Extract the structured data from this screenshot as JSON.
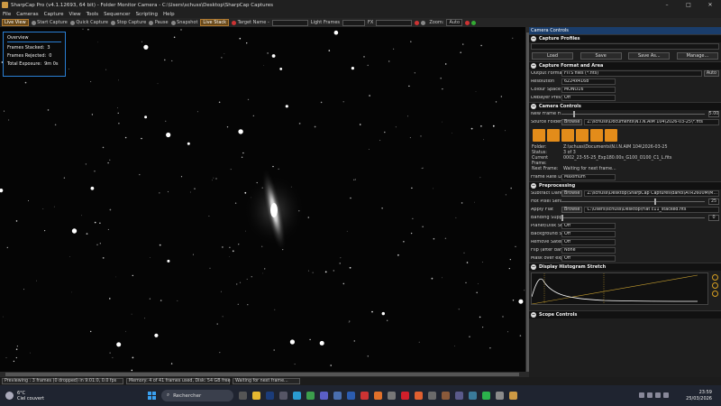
{
  "window": {
    "title": "SharpCap Pro (v4.1.12693, 64 bit) - Folder Monitor Camera - C:\\Users\\schuss\\Desktop\\SharpCap Captures",
    "minimize": "–",
    "maximize": "□",
    "close": "✕"
  },
  "menu": [
    "File",
    "Cameras",
    "Capture",
    "View",
    "Tools",
    "Sequencer",
    "Scripting",
    "Help"
  ],
  "toolbar": {
    "live_view": "Live View",
    "start_capture": "Start Capture",
    "quick_capture": "Quick Capture",
    "stop_capture": "Stop Capture",
    "pause": "Pause",
    "snapshot": "Snapshot",
    "live_stack": "Live Stack",
    "target_name": "Target Name -",
    "light_frames": "Light Frames",
    "fx": "FX",
    "zoom": "Zoom:",
    "zoom_value": "Auto"
  },
  "overview": {
    "title": "Overview",
    "frames_stacked_label": "Frames Stacked:",
    "frames_stacked": "3",
    "frames_rejected_label": "Frames Rejected:",
    "frames_rejected": "0",
    "total_exposure_label": "Total Exposure:",
    "total_exposure": "9m 0s"
  },
  "panel": {
    "title": "Camera Controls",
    "capture_profiles": {
      "title": "Capture Profiles",
      "load": "Load",
      "save": "Save",
      "save_as": "Save As...",
      "manage": "Manage..."
    },
    "capture_format": {
      "title": "Capture Format and Area",
      "output_format_label": "Output Format",
      "output_format": "FITS files (*.fits)",
      "auto": "Auto",
      "resolution_label": "Resolution",
      "resolution": "6224x4168",
      "colour_space_label": "Colour Space",
      "colour_space": "MONO16",
      "debayer_label": "Debayer Preview",
      "debayer": "Off"
    },
    "camera_controls": {
      "title": "Camera Controls",
      "new_frame_label": "New Frame File Delay (s)",
      "new_frame_value": "5.00",
      "source_folder_label": "Source Folder",
      "browse": "Browse",
      "source_folder": "Z:\\schuss\\Documents\\N.I.N.AIM 104\\2026-03-25\\*.fits",
      "folder_label": "Folder:",
      "folder": "Z:\\schuss\\Documents\\N.I.N.AIM 104\\2026-03-25",
      "status_label": "Status:",
      "status": "3 of 3",
      "current_frame_label": "Current Frame:",
      "current_frame": "0002_23-55-25_Exp180.00s_G100_O100_C1_L.fits",
      "next_frame_label": "Next Frame:",
      "next_frame": "Waiting for next frame...",
      "frame_rate_label": "Frame Rate Limit",
      "frame_rate": "Maximum"
    },
    "preprocessing": {
      "title": "Preprocessing",
      "subtract_dark_label": "Subtract Dark",
      "subtract_dark": "Z:\\schuss\\Desktop\\SharpCap Captures\\darks\\ATR2600M\\M...",
      "hot_pixel_label": "Hot Pixel Sensitivity",
      "hot_pixel_value": "25",
      "apply_flat_label": "Apply Flat",
      "apply_flat": "C:\\Users\\schuss\\Desktop\\Flat c11_stacked.fits",
      "banding_label": "Banding Suppression",
      "banding_value": "0",
      "planet_label": "Planet/Disk Stabilization",
      "planet": "Off",
      "background_label": "Background Subtraction",
      "background": "Off",
      "remove_sat_label": "Remove Satellite Trails",
      "remove_sat": "Off",
      "flip_label": "Flip (after dark/flat)",
      "flip": "None",
      "mask_label": "Mask over exposed pixels",
      "mask": "Off"
    },
    "histogram": {
      "title": "Display Histogram Stretch"
    },
    "scope": {
      "title": "Scope Controls"
    }
  },
  "status": {
    "preview": "Previewing : 3 frames (0 dropped) in 9:01:0, 0.0 fps",
    "memory": "Memory: 4 of 41 frames used, Disk: 54 GB free",
    "waiting": "Waiting for next frame..."
  },
  "taskbar": {
    "temp": "6°C",
    "weather": "Ciel couvert",
    "search": "Rechercher",
    "time": "23:59",
    "date": "25/03/2026"
  },
  "colors": {
    "accent": "#e38c1a",
    "overview_border": "#2a7fd4",
    "panel_title": "#1a3d6b"
  }
}
